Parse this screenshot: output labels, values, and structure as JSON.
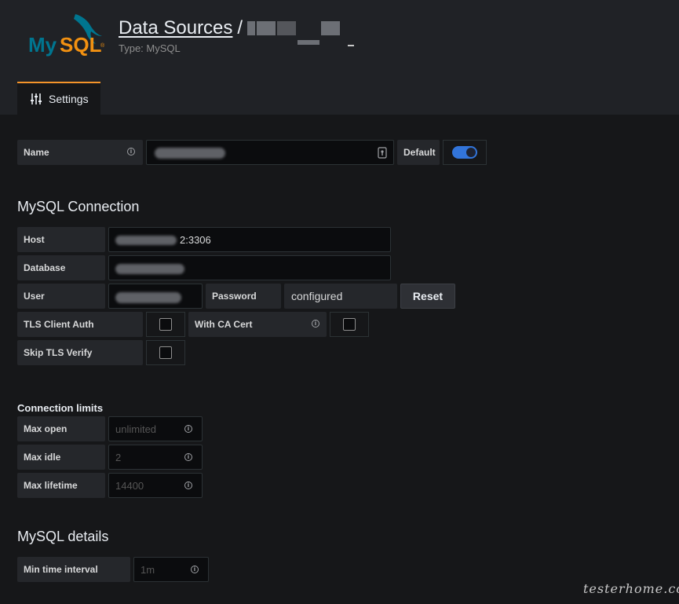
{
  "header": {
    "breadcrumb": "Data Sources",
    "separator": "/",
    "type_label": "Type: MySQL",
    "logo_text": "MySQL"
  },
  "tabs": [
    {
      "label": "Settings",
      "icon": "sliders-icon",
      "active": true
    }
  ],
  "name_row": {
    "label": "Name",
    "default_label": "Default",
    "default_enabled": true
  },
  "mysql_connection": {
    "heading": "MySQL Connection",
    "host_label": "Host",
    "host_value": "2:3306",
    "database_label": "Database",
    "user_label": "User",
    "password_label": "Password",
    "password_value": "configured",
    "reset_label": "Reset",
    "tls_client_auth_label": "TLS Client Auth",
    "with_ca_cert_label": "With CA Cert",
    "skip_tls_verify_label": "Skip TLS Verify"
  },
  "connection_limits": {
    "heading": "Connection limits",
    "max_open_label": "Max open",
    "max_open_placeholder": "unlimited",
    "max_idle_label": "Max idle",
    "max_idle_placeholder": "2",
    "max_lifetime_label": "Max lifetime",
    "max_lifetime_placeholder": "14400"
  },
  "mysql_details": {
    "heading": "MySQL details",
    "min_time_interval_label": "Min time interval",
    "min_time_interval_placeholder": "1m"
  },
  "watermark": "testerhome.com",
  "colors": {
    "accent": "#f4942a",
    "toggle": "#3274d9",
    "mysql_blue": "#00758f",
    "mysql_orange": "#f29111"
  }
}
